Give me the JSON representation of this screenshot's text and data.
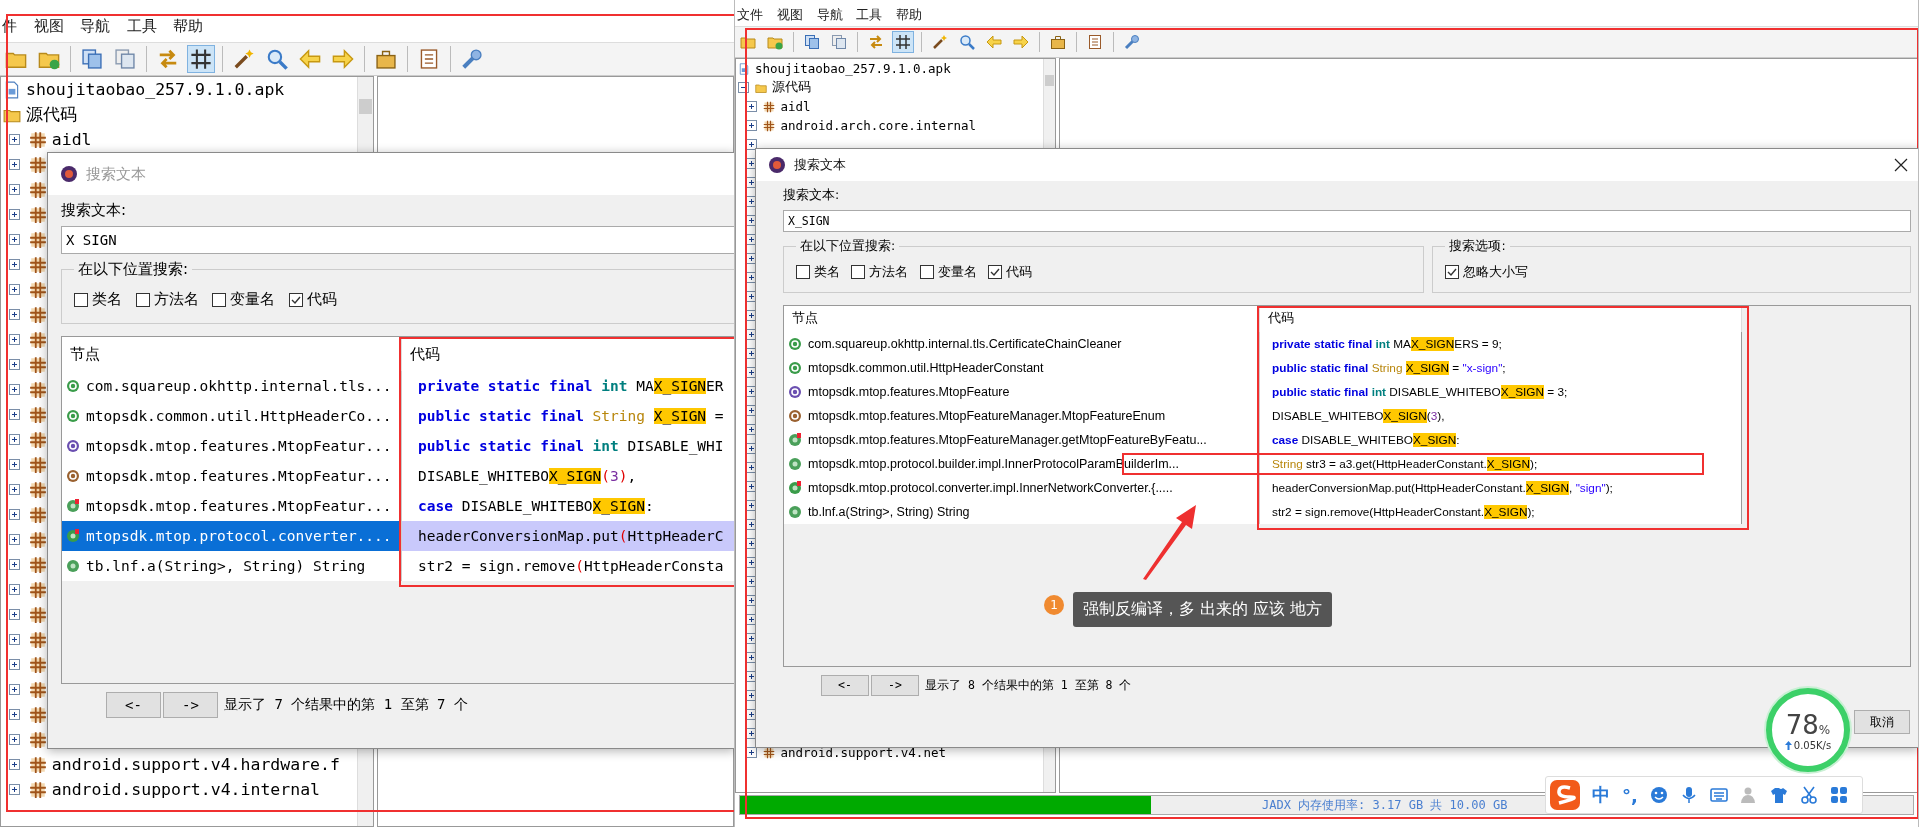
{
  "panels": [
    {
      "menu": [
        "件",
        "视图",
        "导航",
        "工具",
        "帮助"
      ],
      "toolbar": [
        {
          "pressed": false
        },
        {
          "pressed": false
        },
        {
          "pressed": false
        },
        {
          "pressed": false
        },
        {
          "pressed": false
        },
        {
          "pressed": true
        },
        {
          "pressed": false
        },
        {
          "pressed": false
        },
        {
          "pressed": false
        },
        {
          "pressed": false
        },
        {
          "pressed": false
        },
        {
          "pressed": false
        },
        {
          "pressed": false
        }
      ],
      "tree": [
        {
          "label": "shoujitaobao_257.9.1.0.apk",
          "kind": "apk",
          "children": [
            {
              "label": "源代码",
              "kind": "folder",
              "children": [
                {
                  "label": "aidl",
                  "kind": "package",
                  "expanded": false
                },
                {
                  "kind": "package",
                  "expanded": false
                },
                {
                  "kind": "package",
                  "expanded": false
                },
                {
                  "kind": "package",
                  "expanded": false
                },
                {
                  "kind": "package",
                  "expanded": false
                },
                {
                  "kind": "package",
                  "expanded": false
                },
                {
                  "kind": "package",
                  "expanded": false
                },
                {
                  "kind": "package",
                  "expanded": false
                },
                {
                  "kind": "package",
                  "expanded": false
                },
                {
                  "kind": "package",
                  "expanded": false
                },
                {
                  "kind": "package",
                  "expanded": false
                },
                {
                  "kind": "package",
                  "expanded": false
                },
                {
                  "kind": "package",
                  "expanded": false
                },
                {
                  "kind": "package",
                  "expanded": false
                },
                {
                  "kind": "package",
                  "expanded": false
                },
                {
                  "kind": "package",
                  "expanded": false
                },
                {
                  "kind": "package",
                  "expanded": false
                },
                {
                  "kind": "package",
                  "expanded": false
                },
                {
                  "kind": "package",
                  "expanded": false
                },
                {
                  "kind": "package",
                  "expanded": false
                },
                {
                  "kind": "package",
                  "expanded": false
                },
                {
                  "kind": "package",
                  "expanded": false
                },
                {
                  "kind": "package",
                  "expanded": false
                },
                {
                  "kind": "package",
                  "expanded": false
                },
                {
                  "kind": "package",
                  "expanded": false
                },
                {
                  "label": "android.support.v4.hardware.f",
                  "kind": "package",
                  "expanded": false
                },
                {
                  "label": "android.support.v4.internal",
                  "kind": "package",
                  "expanded": false
                }
              ]
            }
          ]
        }
      ],
      "dialog": {
        "title": "搜索文本",
        "active": false,
        "search_label": "搜索文本:",
        "query": "X_SIGN",
        "scope": {
          "title": "在以下位置搜索:",
          "options": [
            {
              "label": "类名",
              "checked": false
            },
            {
              "label": "方法名",
              "checked": false
            },
            {
              "label": "变量名",
              "checked": false
            },
            {
              "label": "代码",
              "checked": true
            }
          ]
        },
        "columns": [
          "节点",
          "代码"
        ],
        "results": [
          {
            "node": "com.squareup.okhttp.internal.tls...",
            "kind": "class",
            "selected": false,
            "code": [
              {
                "kind": "keyword",
                "text": "private static final "
              },
              {
                "kind": "primitive",
                "text": "int "
              },
              {
                "kind": "plain",
                "text": "MA"
              },
              {
                "kind": "match",
                "text": "X_SIGN"
              },
              {
                "kind": "plain",
                "text": "ER"
              }
            ]
          },
          {
            "node": "mtopsdk.common.util.HttpHeaderCo...",
            "kind": "class",
            "selected": false,
            "code": [
              {
                "kind": "keyword",
                "text": "public static final "
              },
              {
                "kind": "type",
                "text": "String "
              },
              {
                "kind": "match",
                "text": "X_SIGN"
              },
              {
                "kind": "plain",
                "text": " ="
              }
            ]
          },
          {
            "node": "mtopsdk.mtop.features.MtopFeatur...",
            "kind": "interface",
            "selected": false,
            "code": [
              {
                "kind": "keyword",
                "text": "public static final "
              },
              {
                "kind": "primitive",
                "text": "int "
              },
              {
                "kind": "plain",
                "text": "DISABLE_WHI"
              }
            ]
          },
          {
            "node": "mtopsdk.mtop.features.MtopFeatur...",
            "kind": "enum",
            "selected": false,
            "code": [
              {
                "kind": "plain",
                "text": "DISABLE_WHITEBO"
              },
              {
                "kind": "match",
                "text": "X_SIGN"
              },
              {
                "kind": "paren",
                "text": "("
              },
              {
                "kind": "number",
                "text": "3"
              },
              {
                "kind": "paren",
                "text": ")"
              },
              {
                "kind": "plain",
                "text": ","
              }
            ]
          },
          {
            "node": "mtopsdk.mtop.features.MtopFeatur...",
            "kind": "static_method",
            "selected": false,
            "code": [
              {
                "kind": "keyword",
                "text": "case "
              },
              {
                "kind": "plain",
                "text": "DISABLE_WHITEBO"
              },
              {
                "kind": "match",
                "text": "X_SIGN"
              },
              {
                "kind": "plain",
                "text": ":"
              }
            ]
          },
          {
            "node": "mtopsdk.mtop.protocol.converter....",
            "kind": "inner",
            "selected": true,
            "code": [
              {
                "kind": "plain",
                "text": "headerConversionMap.put"
              },
              {
                "kind": "paren",
                "text": "("
              },
              {
                "kind": "plain",
                "text": "HttpHeaderC"
              }
            ]
          },
          {
            "node": "tb.lnf.a(String>, String) String",
            "kind": "method",
            "selected": false,
            "code": [
              {
                "kind": "plain",
                "text": "str2 = sign.remove"
              },
              {
                "kind": "paren",
                "text": "("
              },
              {
                "kind": "plain",
                "text": "HttpHeaderConsta"
              }
            ]
          }
        ],
        "prev": "<-",
        "next": "->",
        "summary": "显示了 7 个结果中的第 1 至第 7 个"
      }
    },
    {
      "menu": [
        "文件",
        "视图",
        "导航",
        "工具",
        "帮助"
      ],
      "toolbar": [
        {
          "pressed": false
        },
        {
          "pressed": false
        },
        {
          "pressed": false
        },
        {
          "pressed": false
        },
        {
          "pressed": false
        },
        {
          "pressed": true
        },
        {
          "pressed": false
        },
        {
          "pressed": false
        },
        {
          "pressed": false
        },
        {
          "pressed": false
        },
        {
          "pressed": false
        },
        {
          "pressed": false
        },
        {
          "pressed": false
        }
      ],
      "tree": [
        {
          "label": "shoujitaobao_257.9.1.0.apk",
          "kind": "apk",
          "children": [
            {
              "label": "源代码",
              "kind": "folder",
              "expanded": true,
              "children": [
                {
                  "label": "aidl",
                  "kind": "package",
                  "expanded": false
                },
                {
                  "label": "android.arch.core.internal",
                  "kind": "package",
                  "expanded": false
                },
                {
                  "kind": "package",
                  "expanded": false
                },
                {
                  "kind": "package",
                  "expanded": false
                },
                {
                  "kind": "package",
                  "expanded": false
                },
                {
                  "kind": "package",
                  "expanded": false
                },
                {
                  "kind": "package",
                  "expanded": false
                },
                {
                  "kind": "package",
                  "expanded": false
                },
                {
                  "kind": "package",
                  "expanded": false
                },
                {
                  "kind": "package",
                  "expanded": false
                },
                {
                  "kind": "package",
                  "expanded": false
                },
                {
                  "kind": "package",
                  "expanded": false
                },
                {
                  "kind": "package",
                  "expanded": false
                },
                {
                  "kind": "package",
                  "expanded": false
                },
                {
                  "kind": "package",
                  "expanded": false
                },
                {
                  "kind": "package",
                  "expanded": false
                },
                {
                  "kind": "package",
                  "expanded": false
                },
                {
                  "kind": "package",
                  "expanded": false
                },
                {
                  "kind": "package",
                  "expanded": false
                },
                {
                  "kind": "package",
                  "expanded": false
                },
                {
                  "kind": "package",
                  "expanded": false
                },
                {
                  "kind": "package",
                  "expanded": false
                },
                {
                  "kind": "package",
                  "expanded": false
                },
                {
                  "kind": "package",
                  "expanded": false
                },
                {
                  "kind": "package",
                  "expanded": false
                },
                {
                  "kind": "package",
                  "expanded": false
                },
                {
                  "kind": "package",
                  "expanded": false
                },
                {
                  "kind": "package",
                  "expanded": false
                },
                {
                  "kind": "package",
                  "expanded": false
                },
                {
                  "kind": "package",
                  "expanded": false
                },
                {
                  "kind": "package",
                  "expanded": false
                },
                {
                  "kind": "package",
                  "expanded": false
                },
                {
                  "kind": "package",
                  "expanded": false
                },
                {
                  "kind": "package",
                  "expanded": false
                },
                {
                  "label": "android.support.v4.net",
                  "kind": "package",
                  "expanded": false
                }
              ]
            }
          ]
        }
      ],
      "dialog": {
        "title": "搜索文本",
        "active": true,
        "close_button": true,
        "search_label": "搜索文本:",
        "query": "X_SIGN",
        "scope": {
          "title": "在以下位置搜索:",
          "options": [
            {
              "label": "类名",
              "checked": false
            },
            {
              "label": "方法名",
              "checked": false
            },
            {
              "label": "变量名",
              "checked": false
            },
            {
              "label": "代码",
              "checked": true
            }
          ]
        },
        "options_group": {
          "title": "搜索选项:",
          "options": [
            {
              "label": "忽略大小写",
              "checked": true
            }
          ]
        },
        "columns": [
          "节点",
          "代码"
        ],
        "results": [
          {
            "node": "com.squareup.okhttp.internal.tls.CertificateChainCleaner",
            "kind": "class",
            "selected": false,
            "marked": false,
            "code": [
              {
                "kind": "keyword",
                "text": "private static final "
              },
              {
                "kind": "primitive",
                "text": "int "
              },
              {
                "kind": "plain",
                "text": "MA"
              },
              {
                "kind": "match",
                "text": "X_SIGN"
              },
              {
                "kind": "plain",
                "text": "ERS = 9;"
              }
            ]
          },
          {
            "node": "mtopsdk.common.util.HttpHeaderConstant",
            "kind": "class",
            "selected": false,
            "marked": false,
            "code": [
              {
                "kind": "keyword",
                "text": "public static final "
              },
              {
                "kind": "type",
                "text": "String "
              },
              {
                "kind": "match",
                "text": "X_SIGN"
              },
              {
                "kind": "plain",
                "text": " = "
              },
              {
                "kind": "string",
                "text": "\"x-sign\""
              },
              {
                "kind": "plain",
                "text": ";"
              }
            ]
          },
          {
            "node": "mtopsdk.mtop.features.MtopFeature",
            "kind": "interface",
            "selected": false,
            "marked": false,
            "code": [
              {
                "kind": "keyword",
                "text": "public static final "
              },
              {
                "kind": "primitive",
                "text": "int "
              },
              {
                "kind": "plain",
                "text": "DISABLE_WHITEBO"
              },
              {
                "kind": "match",
                "text": "X_SIGN"
              },
              {
                "kind": "plain",
                "text": " = 3;"
              }
            ]
          },
          {
            "node": "mtopsdk.mtop.features.MtopFeatureManager.MtopFeatureEnum",
            "kind": "enum",
            "selected": false,
            "marked": false,
            "code": [
              {
                "kind": "plain",
                "text": "DISABLE_WHITEBO"
              },
              {
                "kind": "match",
                "text": "X_SIGN"
              },
              {
                "kind": "plain",
                "text": "("
              },
              {
                "kind": "number",
                "text": "3"
              },
              {
                "kind": "plain",
                "text": "),"
              }
            ]
          },
          {
            "node": "mtopsdk.mtop.features.MtopFeatureManager.getMtopFeatureByFeatu...",
            "kind": "static_method",
            "selected": false,
            "marked": false,
            "code": [
              {
                "kind": "keyword",
                "text": "case "
              },
              {
                "kind": "plain",
                "text": "DISABLE_WHITEBO"
              },
              {
                "kind": "match",
                "text": "X_SIGN"
              },
              {
                "kind": "plain",
                "text": ":"
              }
            ]
          },
          {
            "node": "mtopsdk.mtop.protocol.builder.impl.InnerProtocolParamBuilderIm...",
            "kind": "method",
            "selected": false,
            "marked": true,
            "code": [
              {
                "kind": "type",
                "text": "String "
              },
              {
                "kind": "plain",
                "text": "str3 = a3.get(HttpHeaderConstant."
              },
              {
                "kind": "match",
                "text": "X_SIGN"
              },
              {
                "kind": "plain",
                "text": ");"
              }
            ]
          },
          {
            "node": "mtopsdk.mtop.protocol.converter.impl.InnerNetworkConverter.{.....",
            "kind": "inner",
            "selected": false,
            "marked": false,
            "code": [
              {
                "kind": "plain",
                "text": "headerConversionMap.put(HttpHeaderConstant."
              },
              {
                "kind": "match",
                "text": "X_SIGN"
              },
              {
                "kind": "plain",
                "text": ", "
              },
              {
                "kind": "string",
                "text": "\"sign\""
              },
              {
                "kind": "plain",
                "text": ");"
              }
            ]
          },
          {
            "node": "tb.lnf.a(String>, String) String",
            "kind": "method",
            "selected": false,
            "marked": false,
            "code": [
              {
                "kind": "plain",
                "text": "str2 = sign.remove(HttpHeaderConstant."
              },
              {
                "kind": "match",
                "text": "X_SIGN"
              },
              {
                "kind": "plain",
                "text": ");"
              }
            ]
          }
        ],
        "prev": "<-",
        "next": "->",
        "summary": "显示了 8 个结果中的第 1 至第 8 个",
        "buttons": [
          "取消"
        ]
      },
      "status": {
        "text": "JADX 内存使用率: 3.17 GB 共 10.00 GB",
        "level": 0.35
      }
    }
  ],
  "callout": {
    "badge": "1",
    "text": "强制反编译，多 出来的 应该 地方"
  },
  "speed_widget": {
    "percent": "78",
    "unit": "%",
    "rate": "0.05K/s"
  },
  "ime_bar": {
    "items": [
      "中",
      "°,"
    ]
  }
}
